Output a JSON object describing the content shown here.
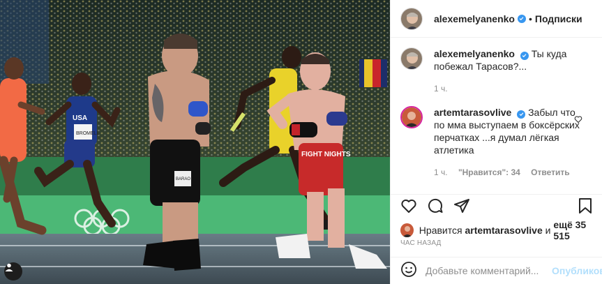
{
  "post": {
    "author": "alexemelyanenko",
    "follow_label": "Подписки",
    "dot": "•"
  },
  "caption": {
    "author": "alexemelyanenko",
    "text": "Ты куда побежал Тарасов?...",
    "time": "1 ч."
  },
  "reply": {
    "author": "artemtarasovlive",
    "text": "Забыл что по мма выступаем в боксёрских перчатках ...я думал лёгкая атлетика",
    "time": "1 ч.",
    "likes": "\"Нравится\": 34",
    "reply_label": "Ответить"
  },
  "likes": {
    "prefix": "Нравится",
    "user": "artemtarasovlive",
    "middle": "и",
    "count": "ещё 35 515"
  },
  "timeago": "ЧАС НАЗАД",
  "comment_box": {
    "placeholder": "Добавьте комментарий...",
    "publish_label": "Опубликовать"
  },
  "photo": {
    "shorts_text": "FIGHT NIGHTS",
    "bib_left": "BROMELL",
    "jersey_left": "USA",
    "shorts_left": "BARAO"
  },
  "colors": {
    "verified": "#3897f0",
    "publish": "#b2dffc",
    "meta": "#8e8e8e"
  }
}
